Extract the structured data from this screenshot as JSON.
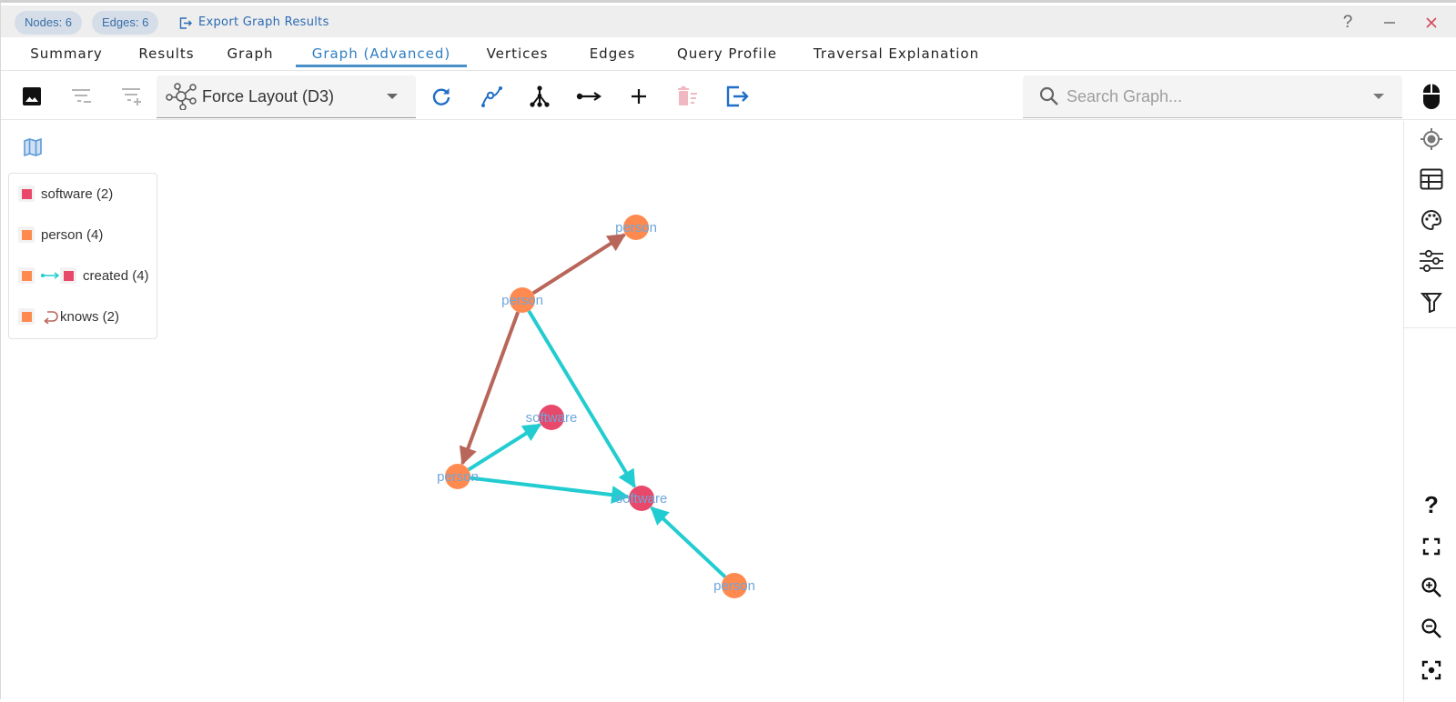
{
  "header": {
    "nodes_chip": "Nodes: 6",
    "edges_chip": "Edges: 6",
    "export_label": "Export Graph Results",
    "help_symbol": "?",
    "minimize_symbol": "—",
    "close_symbol": "✕"
  },
  "tabs": [
    {
      "label": "Summary",
      "active": false
    },
    {
      "label": "Results",
      "active": false
    },
    {
      "label": "Graph",
      "active": false
    },
    {
      "label": "Graph (Advanced)",
      "active": true
    },
    {
      "label": "Vertices",
      "active": false
    },
    {
      "label": "Edges",
      "active": false
    },
    {
      "label": "Query Profile",
      "active": false
    },
    {
      "label": "Traversal Explanation",
      "active": false
    }
  ],
  "toolbar": {
    "icons": [
      "image-icon",
      "filter-remove-icon",
      "filter-add-icon",
      "refresh-icon",
      "curve-edit-icon",
      "hierarchy-icon",
      "edge-arrow-icon",
      "add-icon",
      "delete-icon",
      "export-icon"
    ],
    "layout_select": "Force Layout (D3)",
    "search_placeholder": "Search Graph..."
  },
  "legend": {
    "items": [
      {
        "label": "software (2)",
        "type": "node",
        "color": "#e8486a"
      },
      {
        "label": "person (4)",
        "type": "node",
        "color": "#ff8a50"
      },
      {
        "label": "created (4)",
        "type": "edge",
        "from_color": "#ff8a50",
        "to_color": "#e8486a",
        "edge_color": "#22ccd0"
      },
      {
        "label": "knows (2)",
        "type": "self-edge",
        "from_color": "#ff8a50",
        "edge_color": "#b8665a"
      }
    ]
  },
  "right_sidebar": {
    "top_icons": [
      "target-icon",
      "table-icon",
      "palette-icon",
      "sliders-icon",
      "filter-icon"
    ],
    "bottom_icons": [
      "help-icon",
      "fit-screen-icon",
      "zoom-in-icon",
      "zoom-out-icon",
      "center-focus-icon"
    ]
  },
  "colors": {
    "person": "#ff8a50",
    "software": "#e8486a",
    "knows_edge": "#b8665a",
    "created_edge": "#22ccd0",
    "node_label": "#6ea6dc",
    "accent": "#2f7fc1"
  },
  "graph": {
    "nodes": [
      {
        "id": "p1",
        "label": "person",
        "type": "person"
      },
      {
        "id": "p2",
        "label": "person",
        "type": "person"
      },
      {
        "id": "s1",
        "label": "software",
        "type": "software"
      },
      {
        "id": "p3",
        "label": "person",
        "type": "person"
      },
      {
        "id": "s2",
        "label": "software",
        "type": "software"
      },
      {
        "id": "p4",
        "label": "person",
        "type": "person"
      }
    ],
    "edges": [
      {
        "source": "p2",
        "target": "p1",
        "label": "knows"
      },
      {
        "source": "p2",
        "target": "p3",
        "label": "knows"
      },
      {
        "source": "p2",
        "target": "s2",
        "label": "created"
      },
      {
        "source": "p3",
        "target": "s1",
        "label": "created"
      },
      {
        "source": "p3",
        "target": "s2",
        "label": "created"
      },
      {
        "source": "p4",
        "target": "s2",
        "label": "created"
      }
    ]
  }
}
